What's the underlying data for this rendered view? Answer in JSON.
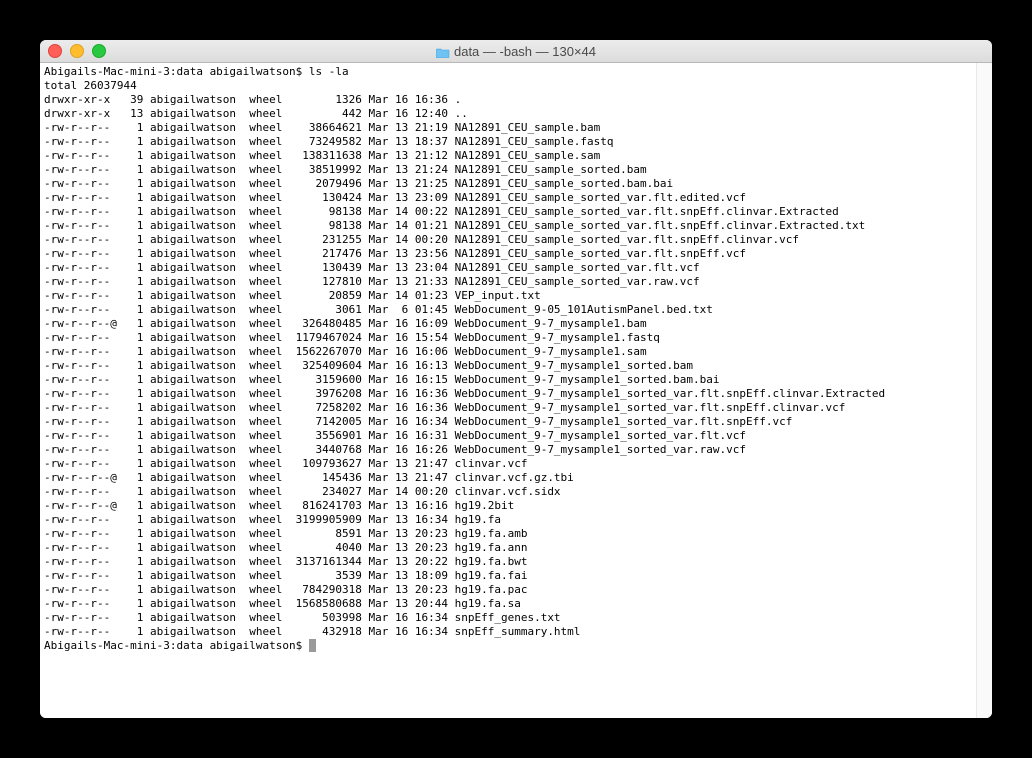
{
  "window": {
    "title": "data — -bash — 130×44"
  },
  "terminal": {
    "prompt_line": "Abigails-Mac-mini-3:data abigailwatson$ ls -la",
    "total_line": "total 26037944",
    "rows": [
      {
        "perm": "drwxr-xr-x",
        "links": "39",
        "owner": "abigailwatson",
        "group": "wheel",
        "size": "1326",
        "date": "Mar 16 16:36",
        "name": "."
      },
      {
        "perm": "drwxr-xr-x",
        "links": "13",
        "owner": "abigailwatson",
        "group": "wheel",
        "size": "442",
        "date": "Mar 16 12:40",
        "name": ".."
      },
      {
        "perm": "-rw-r--r--",
        "links": "1",
        "owner": "abigailwatson",
        "group": "wheel",
        "size": "38664621",
        "date": "Mar 13 21:19",
        "name": "NA12891_CEU_sample.bam"
      },
      {
        "perm": "-rw-r--r--",
        "links": "1",
        "owner": "abigailwatson",
        "group": "wheel",
        "size": "73249582",
        "date": "Mar 13 18:37",
        "name": "NA12891_CEU_sample.fastq"
      },
      {
        "perm": "-rw-r--r--",
        "links": "1",
        "owner": "abigailwatson",
        "group": "wheel",
        "size": "138311638",
        "date": "Mar 13 21:12",
        "name": "NA12891_CEU_sample.sam"
      },
      {
        "perm": "-rw-r--r--",
        "links": "1",
        "owner": "abigailwatson",
        "group": "wheel",
        "size": "38519992",
        "date": "Mar 13 21:24",
        "name": "NA12891_CEU_sample_sorted.bam"
      },
      {
        "perm": "-rw-r--r--",
        "links": "1",
        "owner": "abigailwatson",
        "group": "wheel",
        "size": "2079496",
        "date": "Mar 13 21:25",
        "name": "NA12891_CEU_sample_sorted.bam.bai"
      },
      {
        "perm": "-rw-r--r--",
        "links": "1",
        "owner": "abigailwatson",
        "group": "wheel",
        "size": "130424",
        "date": "Mar 13 23:09",
        "name": "NA12891_CEU_sample_sorted_var.flt.edited.vcf"
      },
      {
        "perm": "-rw-r--r--",
        "links": "1",
        "owner": "abigailwatson",
        "group": "wheel",
        "size": "98138",
        "date": "Mar 14 00:22",
        "name": "NA12891_CEU_sample_sorted_var.flt.snpEff.clinvar.Extracted"
      },
      {
        "perm": "-rw-r--r--",
        "links": "1",
        "owner": "abigailwatson",
        "group": "wheel",
        "size": "98138",
        "date": "Mar 14 01:21",
        "name": "NA12891_CEU_sample_sorted_var.flt.snpEff.clinvar.Extracted.txt"
      },
      {
        "perm": "-rw-r--r--",
        "links": "1",
        "owner": "abigailwatson",
        "group": "wheel",
        "size": "231255",
        "date": "Mar 14 00:20",
        "name": "NA12891_CEU_sample_sorted_var.flt.snpEff.clinvar.vcf"
      },
      {
        "perm": "-rw-r--r--",
        "links": "1",
        "owner": "abigailwatson",
        "group": "wheel",
        "size": "217476",
        "date": "Mar 13 23:56",
        "name": "NA12891_CEU_sample_sorted_var.flt.snpEff.vcf"
      },
      {
        "perm": "-rw-r--r--",
        "links": "1",
        "owner": "abigailwatson",
        "group": "wheel",
        "size": "130439",
        "date": "Mar 13 23:04",
        "name": "NA12891_CEU_sample_sorted_var.flt.vcf"
      },
      {
        "perm": "-rw-r--r--",
        "links": "1",
        "owner": "abigailwatson",
        "group": "wheel",
        "size": "127810",
        "date": "Mar 13 21:33",
        "name": "NA12891_CEU_sample_sorted_var.raw.vcf"
      },
      {
        "perm": "-rw-r--r--",
        "links": "1",
        "owner": "abigailwatson",
        "group": "wheel",
        "size": "20859",
        "date": "Mar 14 01:23",
        "name": "VEP_input.txt"
      },
      {
        "perm": "-rw-r--r--",
        "links": "1",
        "owner": "abigailwatson",
        "group": "wheel",
        "size": "3061",
        "date": "Mar  6 01:45",
        "name": "WebDocument_9-05_101AutismPanel.bed.txt"
      },
      {
        "perm": "-rw-r--r--@",
        "links": "1",
        "owner": "abigailwatson",
        "group": "wheel",
        "size": "326480485",
        "date": "Mar 16 16:09",
        "name": "WebDocument_9-7_mysample1.bam"
      },
      {
        "perm": "-rw-r--r--",
        "links": "1",
        "owner": "abigailwatson",
        "group": "wheel",
        "size": "1179467024",
        "date": "Mar 16 15:54",
        "name": "WebDocument_9-7_mysample1.fastq"
      },
      {
        "perm": "-rw-r--r--",
        "links": "1",
        "owner": "abigailwatson",
        "group": "wheel",
        "size": "1562267070",
        "date": "Mar 16 16:06",
        "name": "WebDocument_9-7_mysample1.sam"
      },
      {
        "perm": "-rw-r--r--",
        "links": "1",
        "owner": "abigailwatson",
        "group": "wheel",
        "size": "325409604",
        "date": "Mar 16 16:13",
        "name": "WebDocument_9-7_mysample1_sorted.bam"
      },
      {
        "perm": "-rw-r--r--",
        "links": "1",
        "owner": "abigailwatson",
        "group": "wheel",
        "size": "3159600",
        "date": "Mar 16 16:15",
        "name": "WebDocument_9-7_mysample1_sorted.bam.bai"
      },
      {
        "perm": "-rw-r--r--",
        "links": "1",
        "owner": "abigailwatson",
        "group": "wheel",
        "size": "3976208",
        "date": "Mar 16 16:36",
        "name": "WebDocument_9-7_mysample1_sorted_var.flt.snpEff.clinvar.Extracted"
      },
      {
        "perm": "-rw-r--r--",
        "links": "1",
        "owner": "abigailwatson",
        "group": "wheel",
        "size": "7258202",
        "date": "Mar 16 16:36",
        "name": "WebDocument_9-7_mysample1_sorted_var.flt.snpEff.clinvar.vcf"
      },
      {
        "perm": "-rw-r--r--",
        "links": "1",
        "owner": "abigailwatson",
        "group": "wheel",
        "size": "7142005",
        "date": "Mar 16 16:34",
        "name": "WebDocument_9-7_mysample1_sorted_var.flt.snpEff.vcf"
      },
      {
        "perm": "-rw-r--r--",
        "links": "1",
        "owner": "abigailwatson",
        "group": "wheel",
        "size": "3556901",
        "date": "Mar 16 16:31",
        "name": "WebDocument_9-7_mysample1_sorted_var.flt.vcf"
      },
      {
        "perm": "-rw-r--r--",
        "links": "1",
        "owner": "abigailwatson",
        "group": "wheel",
        "size": "3440768",
        "date": "Mar 16 16:26",
        "name": "WebDocument_9-7_mysample1_sorted_var.raw.vcf"
      },
      {
        "perm": "-rw-r--r--",
        "links": "1",
        "owner": "abigailwatson",
        "group": "wheel",
        "size": "109793627",
        "date": "Mar 13 21:47",
        "name": "clinvar.vcf"
      },
      {
        "perm": "-rw-r--r--@",
        "links": "1",
        "owner": "abigailwatson",
        "group": "wheel",
        "size": "145436",
        "date": "Mar 13 21:47",
        "name": "clinvar.vcf.gz.tbi"
      },
      {
        "perm": "-rw-r--r--",
        "links": "1",
        "owner": "abigailwatson",
        "group": "wheel",
        "size": "234027",
        "date": "Mar 14 00:20",
        "name": "clinvar.vcf.sidx"
      },
      {
        "perm": "-rw-r--r--@",
        "links": "1",
        "owner": "abigailwatson",
        "group": "wheel",
        "size": "816241703",
        "date": "Mar 13 16:16",
        "name": "hg19.2bit"
      },
      {
        "perm": "-rw-r--r--",
        "links": "1",
        "owner": "abigailwatson",
        "group": "wheel",
        "size": "3199905909",
        "date": "Mar 13 16:34",
        "name": "hg19.fa"
      },
      {
        "perm": "-rw-r--r--",
        "links": "1",
        "owner": "abigailwatson",
        "group": "wheel",
        "size": "8591",
        "date": "Mar 13 20:23",
        "name": "hg19.fa.amb"
      },
      {
        "perm": "-rw-r--r--",
        "links": "1",
        "owner": "abigailwatson",
        "group": "wheel",
        "size": "4040",
        "date": "Mar 13 20:23",
        "name": "hg19.fa.ann"
      },
      {
        "perm": "-rw-r--r--",
        "links": "1",
        "owner": "abigailwatson",
        "group": "wheel",
        "size": "3137161344",
        "date": "Mar 13 20:22",
        "name": "hg19.fa.bwt"
      },
      {
        "perm": "-rw-r--r--",
        "links": "1",
        "owner": "abigailwatson",
        "group": "wheel",
        "size": "3539",
        "date": "Mar 13 18:09",
        "name": "hg19.fa.fai"
      },
      {
        "perm": "-rw-r--r--",
        "links": "1",
        "owner": "abigailwatson",
        "group": "wheel",
        "size": "784290318",
        "date": "Mar 13 20:23",
        "name": "hg19.fa.pac"
      },
      {
        "perm": "-rw-r--r--",
        "links": "1",
        "owner": "abigailwatson",
        "group": "wheel",
        "size": "1568580688",
        "date": "Mar 13 20:44",
        "name": "hg19.fa.sa"
      },
      {
        "perm": "-rw-r--r--",
        "links": "1",
        "owner": "abigailwatson",
        "group": "wheel",
        "size": "503998",
        "date": "Mar 16 16:34",
        "name": "snpEff_genes.txt"
      },
      {
        "perm": "-rw-r--r--",
        "links": "1",
        "owner": "abigailwatson",
        "group": "wheel",
        "size": "432918",
        "date": "Mar 16 16:34",
        "name": "snpEff_summary.html"
      }
    ],
    "prompt_end": "Abigails-Mac-mini-3:data abigailwatson$ "
  }
}
